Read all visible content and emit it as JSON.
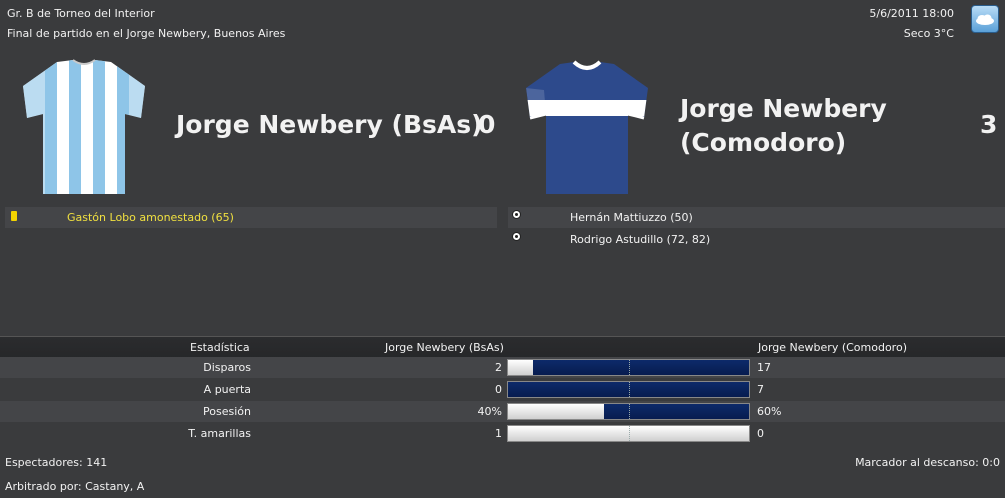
{
  "match": {
    "competition": "Gr. B de Torneo del Interior",
    "venue_line": "Final de partido en el Jorge Newbery, Buenos Aires",
    "datetime": "5/6/2011 18:00",
    "weather": "Seco 3°C",
    "weather_icon": "cloud-icon"
  },
  "home": {
    "name": "Jorge Newbery (BsAs)",
    "score": "0",
    "shirt_colors": [
      "#8ec5e8",
      "#ffffff"
    ],
    "events": [
      {
        "icon": "yellow-card-icon",
        "text": "Gastón Lobo amonestado (65)",
        "color": "#f0e040"
      }
    ]
  },
  "away": {
    "name": "Jorge Newbery (Comodoro)",
    "score": "3",
    "shirt_colors": [
      "#2d4a8c",
      "#ffffff"
    ],
    "events": [
      {
        "icon": "ball-icon",
        "text": "Hernán Mattiuzzo (50)"
      },
      {
        "icon": "ball-icon",
        "text": "Rodrigo Astudillo (72, 82)"
      }
    ]
  },
  "stats": {
    "header_label": "Estadística",
    "header_home": "Jorge Newbery (BsAs)",
    "header_away": "Jorge Newbery (Comodoro)",
    "rows": [
      {
        "label": "Disparos",
        "home": "2",
        "away": "17",
        "away_share": 0.8947
      },
      {
        "label": "A puerta",
        "home": "0",
        "away": "7",
        "away_share": 1.0
      },
      {
        "label": "Posesión",
        "home": "40%",
        "away": "60%",
        "away_share": 0.6
      },
      {
        "label": "T. amarillas",
        "home": "1",
        "away": "0",
        "away_share": 0.0
      }
    ],
    "bar_colors": {
      "home": "#ffffff",
      "away": "#0b2460"
    }
  },
  "footer": {
    "attendance": "Espectadores: 141",
    "halftime": "Marcador al descanso: 0:0",
    "referee": "Arbitrado por: Castany, A"
  }
}
